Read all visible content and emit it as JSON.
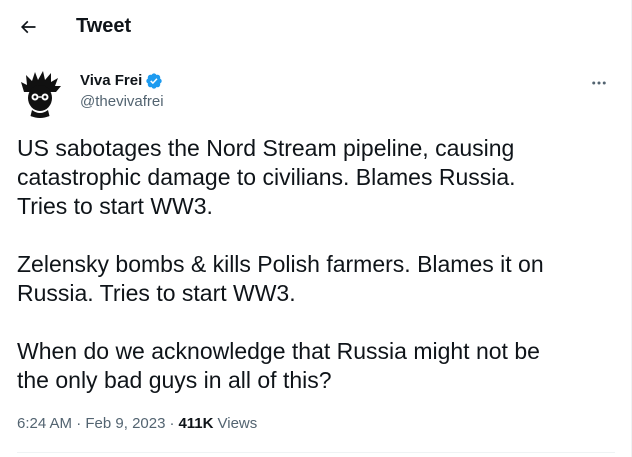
{
  "header": {
    "title": "Tweet",
    "back_icon": "arrow-left-icon"
  },
  "author": {
    "name": "Viva Frei",
    "handle": "@thevivafrei",
    "verified": true,
    "verified_color": "#1d9bf0",
    "avatar_icon": "spiky-hair-avatar"
  },
  "tweet": {
    "paragraphs": [
      {
        "lines": [
          "US sabotages the Nord Stream pipeline, causing",
          "catastrophic damage to civilians. Blames Russia.",
          "Tries to start WW3."
        ]
      },
      {
        "lines": [
          "Zelensky bombs & kills Polish farmers. Blames it on",
          "Russia. Tries to start WW3."
        ]
      },
      {
        "lines": [
          "When do we acknowledge that Russia might not be",
          "the only bad guys in all of this?"
        ]
      }
    ],
    "time": "6:24 AM",
    "date": "Feb 9, 2023",
    "views_count": "411K",
    "views_label": "Views",
    "separator": "·"
  },
  "colors": {
    "text_primary": "#0f1419",
    "text_secondary": "#536471",
    "border": "#eff3f4",
    "accent": "#1d9bf0"
  }
}
